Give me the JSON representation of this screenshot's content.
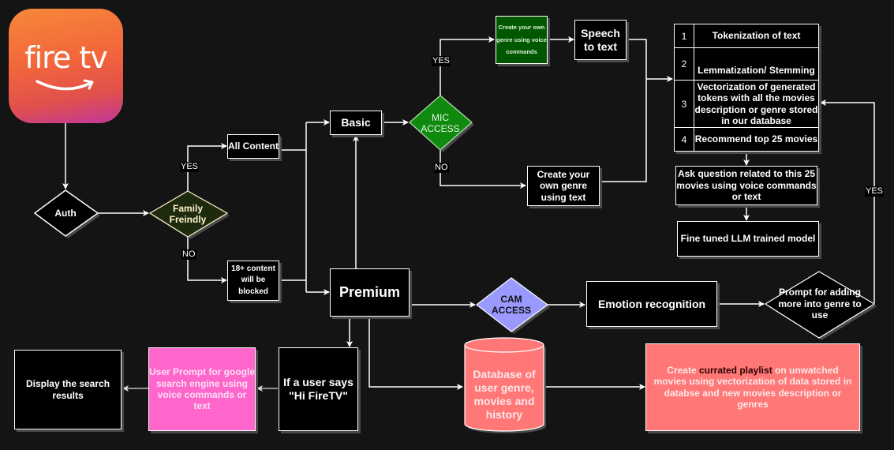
{
  "logo": {
    "text": "fire tv",
    "icon": "firetv-logo-icon",
    "gradient": [
      "#f7883a",
      "#c0389a"
    ]
  },
  "nodes": {
    "auth": "Auth",
    "family_friendly": "Family Freindly",
    "all_content": "All Content",
    "adult_blocked": "18+ content will be blocked",
    "basic": "Basic",
    "premium": "Premium",
    "mic_access": "MIC ACCESS",
    "voice_genre": "Create your own genre using voice commands",
    "speech_to_text": "Speech to text",
    "text_genre": "Create your own genre using text",
    "ask_question": "Ask question related to this 25 movies using voice commands or text",
    "llm_model": "Fine tuned LLM trained model",
    "cam_access": "CAM ACCESS",
    "emotion_recognition": "Emotion recognition",
    "prompt_more": "Prompt for adding more into genre to use",
    "hi_firetv": "If a user says \"Hi FireTV\"",
    "google_prompt": "User Prompt for google search engine using voice commands or text",
    "display_results": "Display the search results",
    "database": "Database of user genre, movies and history",
    "playlist": {
      "prefix": "Create ",
      "highlight": "currated playlist",
      "suffix": "  on unwatched movies using vectorization of data stored in databse and new movies description or genres"
    }
  },
  "pipeline_table": [
    {
      "num": "1",
      "text": "Tokenization of text"
    },
    {
      "num": "2",
      "text": "Lemmatization/ Stemming"
    },
    {
      "num": "3",
      "text": "Vectorization of  generated tokens with all the movies description or genre stored in our database"
    },
    {
      "num": "4",
      "text": "Recommend top 25 movies"
    }
  ],
  "edge_labels": {
    "family_yes": "YES",
    "family_no": "NO",
    "mic_yes": "YES",
    "mic_no": "NO",
    "prompt_yes": "YES"
  },
  "colors": {
    "background": "#141414",
    "family_diamond": "#1e2a0e",
    "family_text": "#fff2cc",
    "mic_diamond": "#0f8a0f",
    "voice_box": "#005700",
    "cam_diamond": "#9999ff",
    "pink_box": "#ff66cc",
    "salmon": "#ff7777"
  }
}
